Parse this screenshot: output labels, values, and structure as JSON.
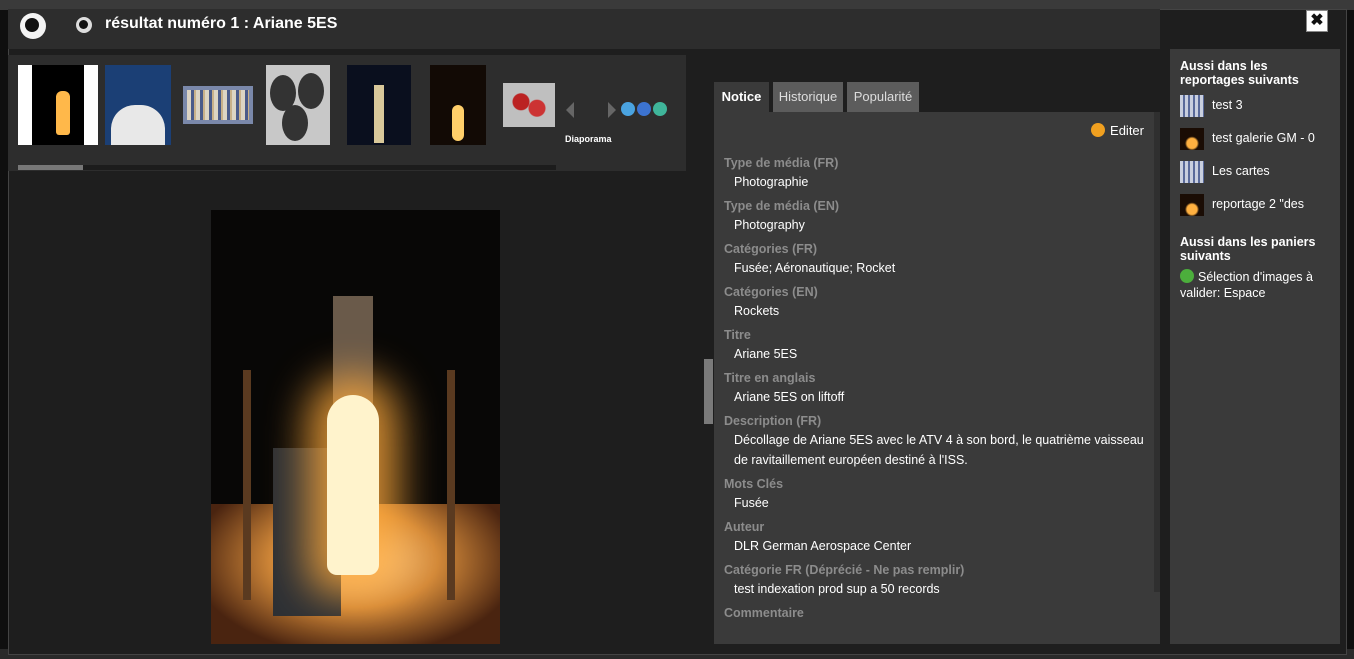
{
  "header": {
    "title": "résultat numéro 1 : Ariane 5ES",
    "close_label": "✖"
  },
  "thumbnails": {
    "diaporama_label": "Diaporama"
  },
  "tabs": [
    {
      "label": "Notice",
      "active": true
    },
    {
      "label": "Historique",
      "active": false
    },
    {
      "label": "Popularité",
      "active": false
    }
  ],
  "notice": {
    "edit_label": "Editer",
    "fields": [
      {
        "label": "Type de média (FR)",
        "value": "Photographie"
      },
      {
        "label": "Type de média (EN)",
        "value": "Photography"
      },
      {
        "label": "Catégories (FR)",
        "value": "Fusée; Aéronautique; Rocket"
      },
      {
        "label": "Catégories (EN)",
        "value": "Rockets"
      },
      {
        "label": "Titre",
        "value": "Ariane 5ES"
      },
      {
        "label": "Titre en anglais",
        "value": "Ariane 5ES on liftoff"
      },
      {
        "label": "Description (FR)",
        "value": "Décollage de Ariane 5ES avec le ATV 4 à son bord, le quatrième vaisseau de ravitaillement européen destiné à l'ISS."
      },
      {
        "label": "Mots Clés",
        "value": "Fusée"
      },
      {
        "label": "Auteur",
        "value": "DLR German Aerospace Center"
      },
      {
        "label": "Catégorie FR (Déprécié - Ne pas remplir)",
        "value": "test indexation prod sup a 50 records"
      },
      {
        "label": "Commentaire",
        "value": ""
      }
    ]
  },
  "side_panel": {
    "reportages_heading": "Aussi dans les reportages suivants",
    "reportages": [
      {
        "label": "test 3",
        "thumb": "blue"
      },
      {
        "label": "test galerie GM - 0",
        "thumb": "fire"
      },
      {
        "label": "Les cartes",
        "thumb": "blue"
      },
      {
        "label": "reportage 2 \"des",
        "thumb": "fire"
      }
    ],
    "baskets_heading": "Aussi dans les paniers suivants",
    "basket_label": "Sélection d'images à valider: Espace"
  }
}
